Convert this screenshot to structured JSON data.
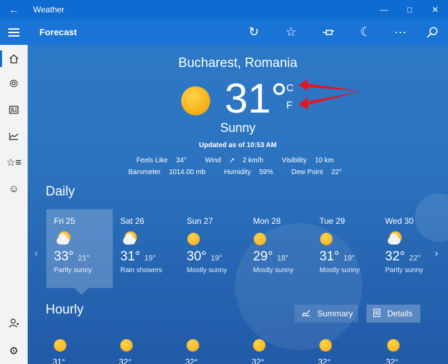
{
  "app": {
    "title": "Weather"
  },
  "header": {
    "section": "Forecast"
  },
  "location": "Bucharest, Romania",
  "current": {
    "temp": "31°",
    "unit_c": "C",
    "unit_f": "F",
    "condition": "Sunny",
    "updated": "Updated as of 10:53 AM",
    "feels_like_label": "Feels Like",
    "feels_like": "34°",
    "wind_label": "Wind",
    "wind": "2 km/h",
    "visibility_label": "Visibility",
    "visibility": "10 km",
    "barometer_label": "Barometer",
    "barometer": "1014.00 mb",
    "humidity_label": "Humidity",
    "humidity": "59%",
    "dewpoint_label": "Dew Point",
    "dewpoint": "22°"
  },
  "daily": {
    "title": "Daily",
    "days": [
      {
        "name": "Fri 25",
        "hi": "33°",
        "lo": "21°",
        "desc": "Partly sunny",
        "icon": "partly-sunny"
      },
      {
        "name": "Sat 26",
        "hi": "31°",
        "lo": "19°",
        "desc": "Rain showers",
        "icon": "rain-showers"
      },
      {
        "name": "Sun 27",
        "hi": "30°",
        "lo": "19°",
        "desc": "Mostly sunny",
        "icon": "sunny"
      },
      {
        "name": "Mon 28",
        "hi": "29°",
        "lo": "18°",
        "desc": "Mostly sunny",
        "icon": "sunny"
      },
      {
        "name": "Tue 29",
        "hi": "31°",
        "lo": "19°",
        "desc": "Mostly sunny",
        "icon": "sunny"
      },
      {
        "name": "Wed 30",
        "hi": "32°",
        "lo": "22°",
        "desc": "Partly sunny",
        "icon": "partly-sunny"
      }
    ]
  },
  "hourly": {
    "title": "Hourly",
    "summary_label": "Summary",
    "details_label": "Details",
    "temps": [
      "31°",
      "32°",
      "32°",
      "32°",
      "32°",
      "32°"
    ]
  },
  "colors": {
    "accent": "#0e6bd1",
    "background": "#2c74c0",
    "annotation_arrow": "#e8141b"
  }
}
